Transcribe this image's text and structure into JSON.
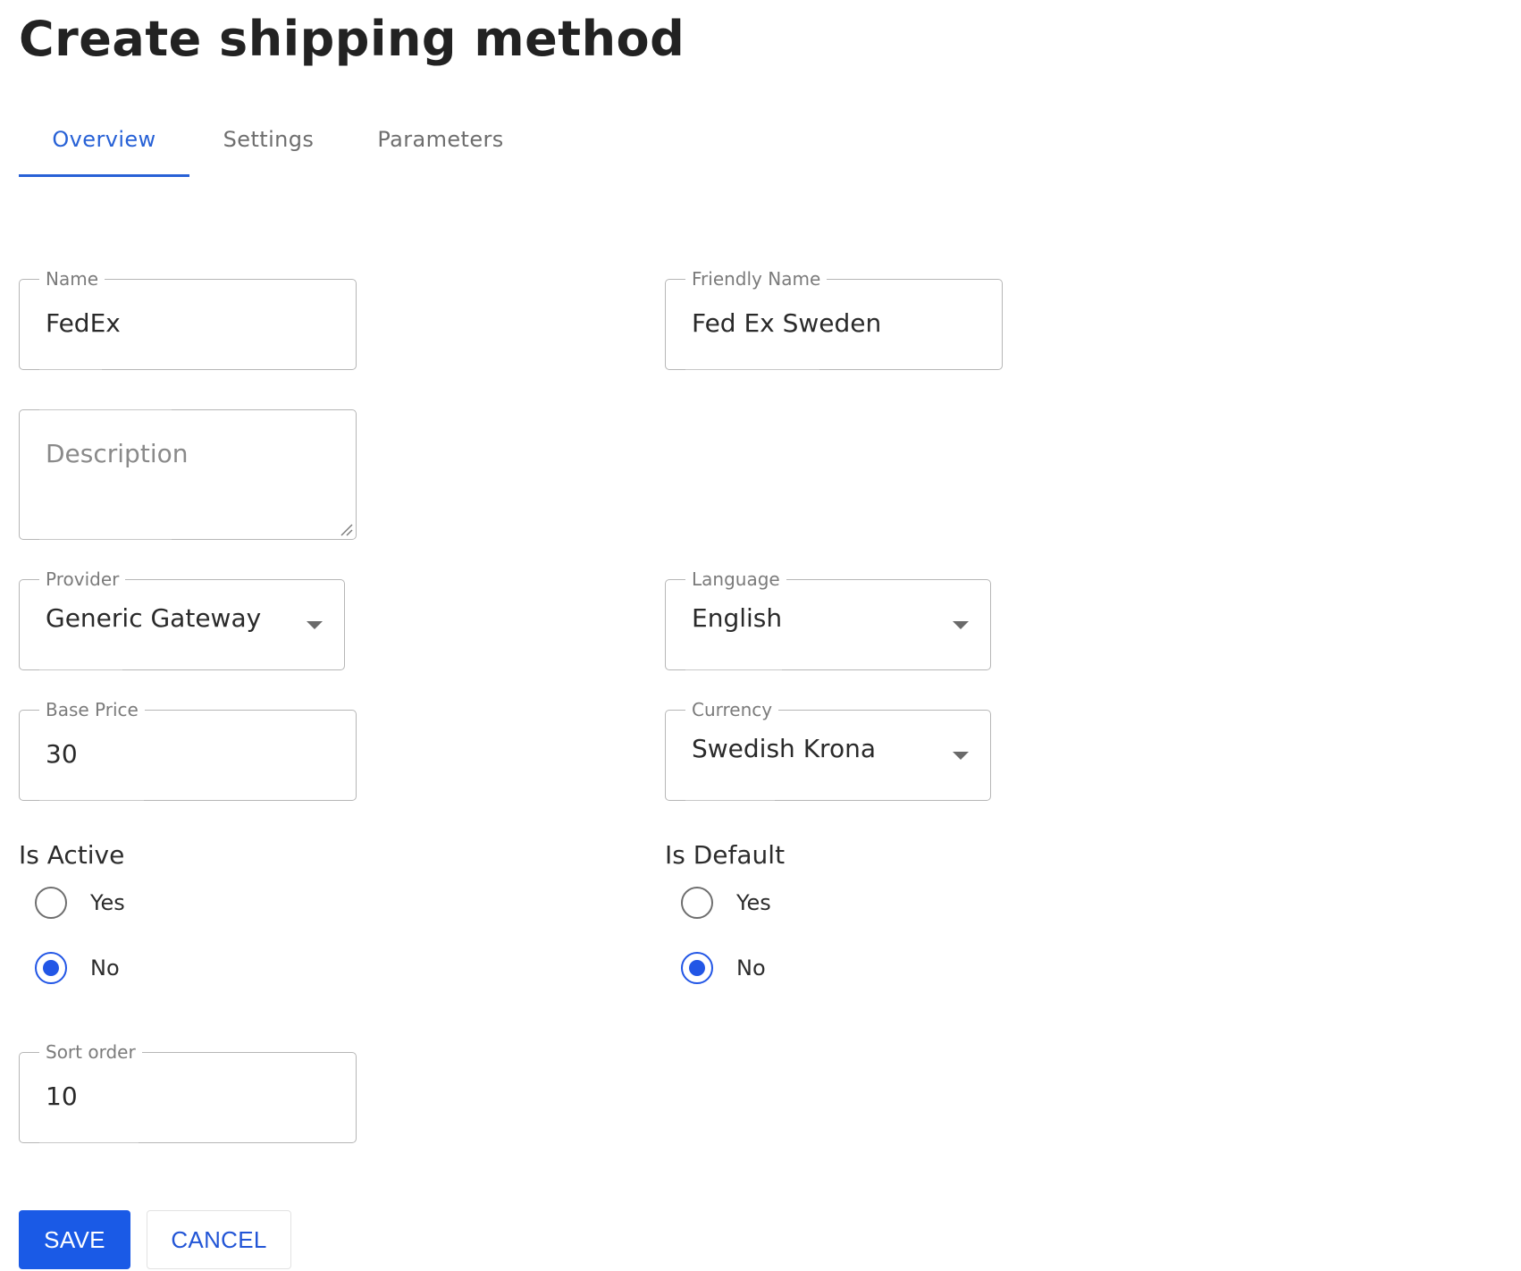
{
  "page": {
    "title": "Create shipping method"
  },
  "tabs": [
    {
      "label": "Overview",
      "active": true
    },
    {
      "label": "Settings",
      "active": false
    },
    {
      "label": "Parameters",
      "active": false
    }
  ],
  "form": {
    "name": {
      "label": "Name",
      "value": "FedEx"
    },
    "friendly_name": {
      "label": "Friendly Name",
      "value": "Fed Ex Sweden"
    },
    "description": {
      "placeholder": "Description",
      "value": ""
    },
    "provider": {
      "label": "Provider",
      "value": "Generic Gateway"
    },
    "language": {
      "label": "Language",
      "value": "English"
    },
    "base_price": {
      "label": "Base Price",
      "value": "30"
    },
    "currency": {
      "label": "Currency",
      "value": "Swedish Krona"
    },
    "is_active": {
      "label": "Is Active",
      "options": [
        "Yes",
        "No"
      ],
      "selected": "No"
    },
    "is_default": {
      "label": "Is Default",
      "options": [
        "Yes",
        "No"
      ],
      "selected": "No"
    },
    "sort_order": {
      "label": "Sort order",
      "value": "10"
    }
  },
  "actions": {
    "save_label": "SAVE",
    "cancel_label": "CANCEL"
  },
  "colors": {
    "accent": "#1a5ae6",
    "tab_active": "#2761d6",
    "border": "#b6b6b6"
  },
  "icons": {
    "dropdown": "caret-down-icon",
    "resize": "resize-handle-icon"
  }
}
